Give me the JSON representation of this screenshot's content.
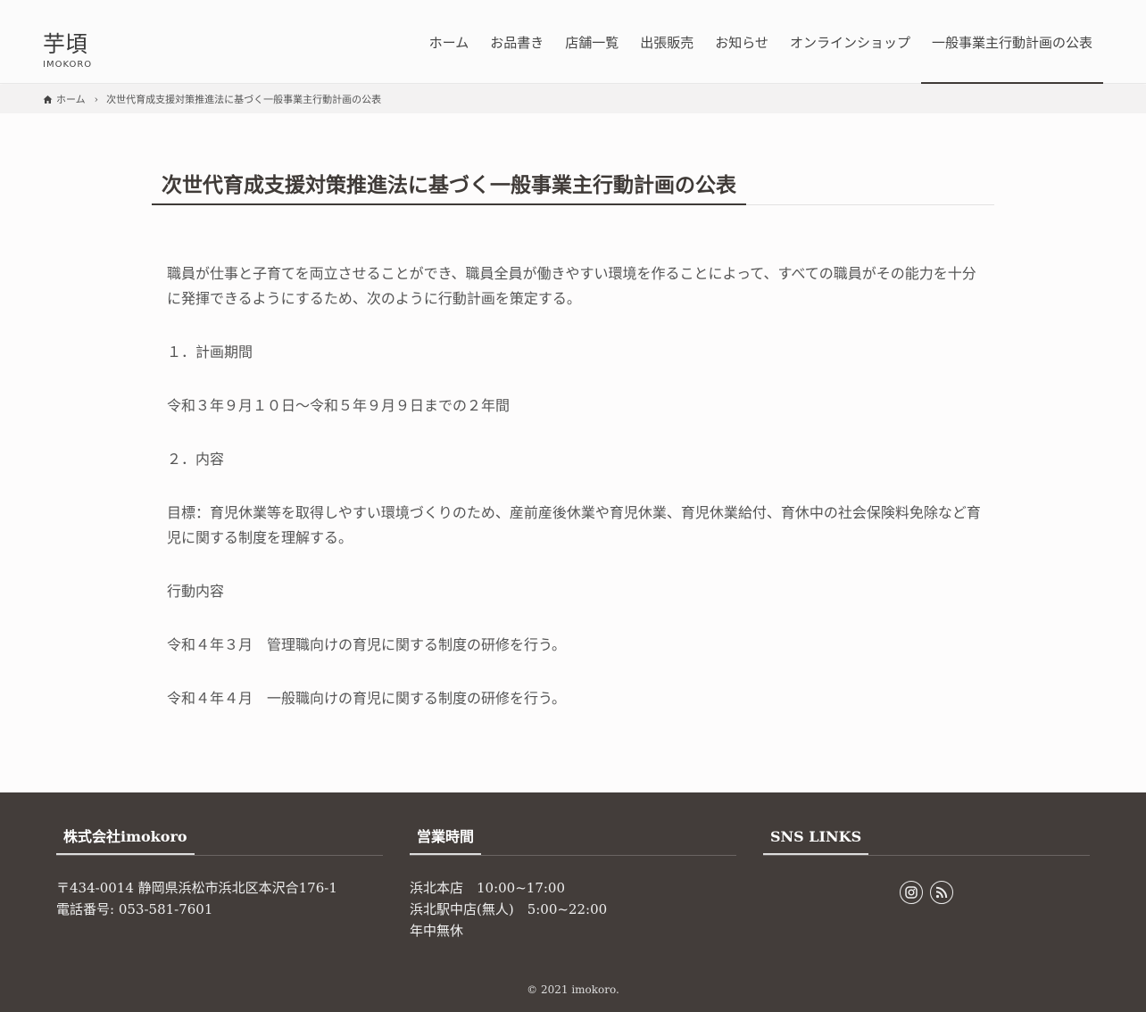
{
  "logo": {
    "kanji": "芋頃",
    "roman": "IMOKORO"
  },
  "nav": [
    {
      "label": "ホーム"
    },
    {
      "label": "お品書き"
    },
    {
      "label": "店舗一覧"
    },
    {
      "label": "出張販売"
    },
    {
      "label": "お知らせ"
    },
    {
      "label": "オンラインショップ"
    },
    {
      "label": "一般事業主行動計画の公表"
    }
  ],
  "breadcrumb": {
    "home": "ホーム",
    "current": "次世代育成支援対策推進法に基づく一般事業主行動計画の公表"
  },
  "page": {
    "title": "次世代育成支援対策推進法に基づく一般事業主行動計画の公表",
    "paragraphs": [
      "職員が仕事と子育てを両立させることができ、職員全員が働きやすい環境を作ることによって、すべての職員がその能力を十分に発揮できるようにするため、次のように行動計画を策定する。",
      "１．計画期間",
      "令和３年９月１０日～令和５年９月９日までの２年間",
      "２．内容",
      "目標：育児休業等を取得しやすい環境づくりのため、産前産後休業や育児休業、育児休業給付、育休中の社会保険料免除など育児に関する制度を理解する。",
      "行動内容",
      "令和４年３月　管理職向けの育児に関する制度の研修を行う。",
      "令和４年４月　一般職向けの育児に関する制度の研修を行う。"
    ]
  },
  "footer": {
    "company": {
      "title": "株式会社imokoro",
      "address": "〒434-0014 静岡県浜松市浜北区本沢合176-1",
      "phone": "電話番号: 053-581-7601"
    },
    "hours": {
      "title": "営業時間",
      "lines": [
        "浜北本店　10:00~17:00",
        "浜北駅中店(無人)　5:00~22:00",
        "年中無休"
      ]
    },
    "sns": {
      "title": "SNS LINKS",
      "icons": [
        "instagram-icon",
        "rss-icon"
      ]
    },
    "copyright": "© 2021 imokoro."
  },
  "colors": {
    "footer_bg": "#433d3a",
    "accent": "#3f3a37"
  }
}
